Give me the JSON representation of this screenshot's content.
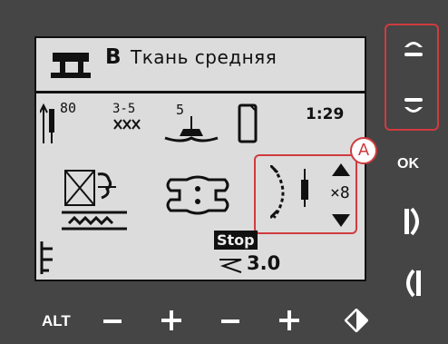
{
  "lcd": {
    "fabric_letter": "B",
    "fabric_name": "Ткань средняя",
    "needle_size": "80",
    "thread_range_top": "3-5",
    "presser_foot": "5",
    "stitch_time": "1:29",
    "repeat_count": "×8",
    "stop_label": "Stop",
    "stitch_width_value": "3.0",
    "callout_label": "A"
  },
  "buttons": {
    "ok_label": "OK",
    "alt_label": "ALT"
  },
  "colors": {
    "panel": "#454545",
    "lcd": "#dcdcdc",
    "highlight": "#cf3b3f"
  },
  "icons": [
    "sewing-machine-icon",
    "needle-icon",
    "thread-tension-icon",
    "presser-foot-icon",
    "bobbin-icon",
    "feed-dog-icon",
    "presser-foot-pressure-icon",
    "stitch-mirror-icon",
    "chevron-up-icon",
    "chevron-down-icon",
    "stitch-length-icon",
    "stitch-width-icon",
    "scroll-up-icon",
    "scroll-down-icon",
    "mirror-side-icon",
    "mirror-end-icon",
    "minus-icon",
    "plus-icon",
    "diamond-icon"
  ]
}
